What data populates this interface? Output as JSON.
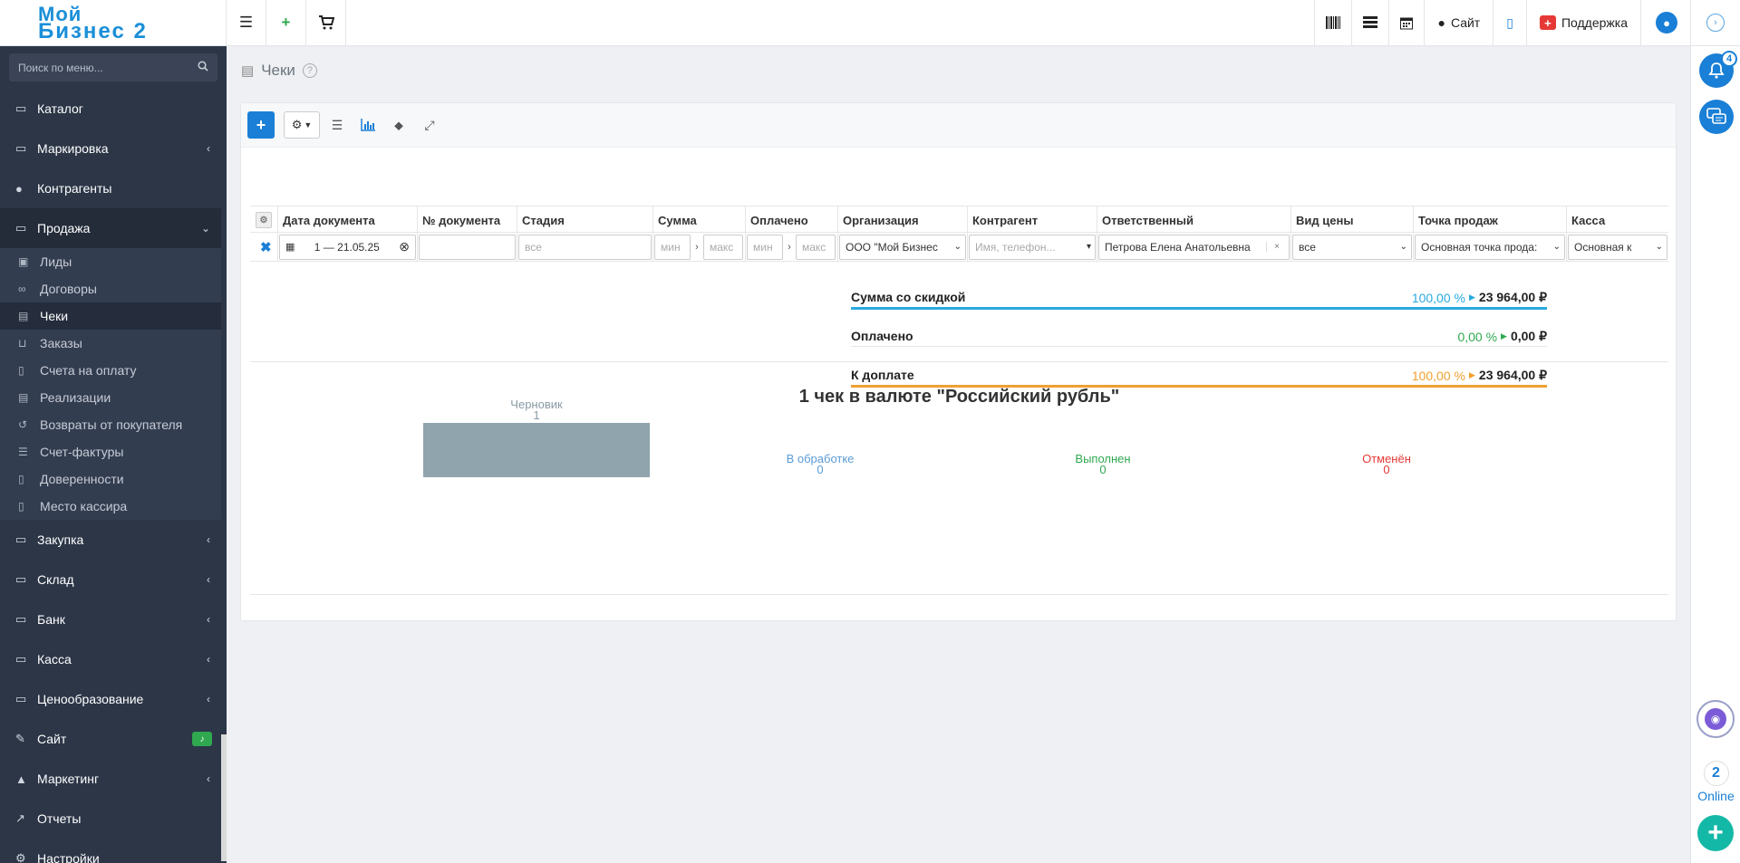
{
  "logo": {
    "line1": "Мой",
    "line2": "Бизнес 2"
  },
  "topbar": {
    "site_label": "Сайт",
    "support_label": "Поддержка"
  },
  "rightrail": {
    "notif_count": "4",
    "online_count": "2",
    "online_label": "Online"
  },
  "sidebar": {
    "search_placeholder": "Поиск по меню...",
    "items": [
      {
        "label": "Каталог",
        "icon": "folder-icon"
      },
      {
        "label": "Маркировка",
        "icon": "folder-icon"
      },
      {
        "label": "Контрагенты",
        "icon": "users-icon"
      },
      {
        "label": "Продажа",
        "icon": "folder-icon"
      }
    ],
    "sales_sub": [
      {
        "label": "Лиды"
      },
      {
        "label": "Договоры"
      },
      {
        "label": "Чеки"
      },
      {
        "label": "Заказы"
      },
      {
        "label": "Счета на оплату"
      },
      {
        "label": "Реализации"
      },
      {
        "label": "Возвраты от покупателя"
      },
      {
        "label": "Счет-фактуры"
      },
      {
        "label": "Доверенности"
      },
      {
        "label": "Место кассира"
      }
    ],
    "items2": [
      {
        "label": "Закупка"
      },
      {
        "label": "Склад"
      },
      {
        "label": "Банк"
      },
      {
        "label": "Касса"
      },
      {
        "label": "Ценообразование"
      },
      {
        "label": "Сайт"
      },
      {
        "label": "Маркетинг"
      },
      {
        "label": "Отчеты"
      },
      {
        "label": "Настройки"
      }
    ]
  },
  "page": {
    "title": "Чеки"
  },
  "filters": {
    "headers": [
      "Дата документа",
      "№ документа",
      "Стадия",
      "Сумма",
      "Оплачено",
      "Организация",
      "Контрагент",
      "Ответственный",
      "Вид цены",
      "Точка продаж",
      "Касса"
    ],
    "date_value": "1 — 21.05.25",
    "stage_placeholder": "все",
    "min_placeholder": "мин",
    "max_placeholder": "макс",
    "org_value": "ООО \"Мой Бизнес",
    "contractor_placeholder": "Имя, телефон...",
    "responsible_value": "Петрова Елена Анатольевна",
    "price_type_value": "все",
    "point_value": "Основная точка прода:",
    "cashbox_value": "Основная к"
  },
  "summary": [
    {
      "label": "Сумма со скидкой",
      "pct": "100,00 %",
      "amount": "23 964,00 ₽",
      "color": "#29a9e0"
    },
    {
      "label": "Оплачено",
      "pct": "0,00 %",
      "amount": "0,00 ₽",
      "color": "#2fa84f"
    },
    {
      "label": "К доплате",
      "pct": "100,00 %",
      "amount": "23 964,00 ₽",
      "color": "#f0a030"
    }
  ],
  "chart_data": {
    "type": "bar",
    "title": "1 чек в валюте \"Российский рубль\"",
    "categories": [
      "Черновик",
      "В обработке",
      "Выполнен",
      "Отменён"
    ],
    "values": [
      1,
      0,
      0,
      0
    ],
    "colors": [
      "#90a4ae",
      "#5b9bd5",
      "#2fa84f",
      "#e53935"
    ]
  }
}
